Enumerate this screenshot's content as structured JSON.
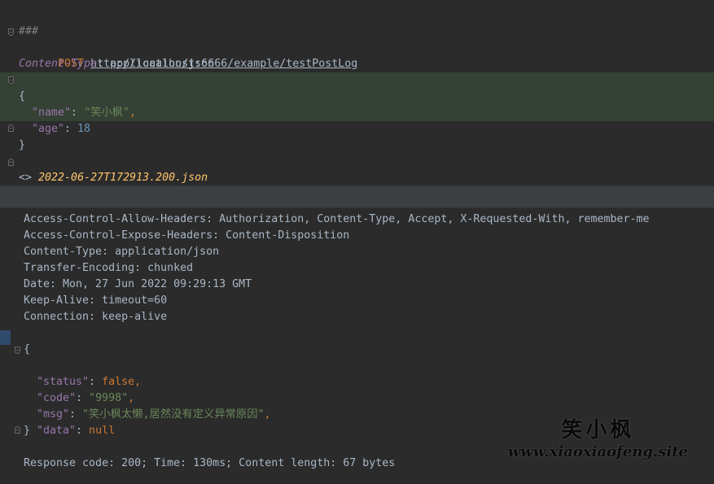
{
  "editor": {
    "separator": "###",
    "method": "POST",
    "url": "http://localhost:6666/example/testPostLog",
    "header_name": "Content-Type",
    "header_sep": ": ",
    "header_value": "application/json",
    "body": {
      "open_brace": "{",
      "line1_key": "\"name\"",
      "line1_colon": ": ",
      "line1_value": "\"笑小枫\"",
      "line1_comma": ",",
      "line2_key": "\"age\"",
      "line2_colon": ": ",
      "line2_value": "18",
      "close_brace": "}"
    },
    "response_ref_prefix": "<> ",
    "response_ref_file": "2022-06-27T172913.200.json"
  },
  "output": {
    "headers": [
      "Access-Control-Allow-Headers: Authorization, Content-Type, Accept, X-Requested-With, remember-me",
      "Access-Control-Expose-Headers: Content-Disposition",
      "Content-Type: application/json",
      "Transfer-Encoding: chunked",
      "Date: Mon, 27 Jun 2022 09:29:13 GMT",
      "Keep-Alive: timeout=60",
      "Connection: keep-alive"
    ],
    "json": {
      "open_brace": "{",
      "status_key": "\"status\"",
      "status_value": "false",
      "code_key": "\"code\"",
      "code_value": "\"9998\"",
      "msg_key": "\"msg\"",
      "msg_value": "\"笑小枫太懒,居然没有定义异常原因\"",
      "data_key": "\"data\"",
      "data_value": "null",
      "colon": ": ",
      "comma": ",",
      "close_brace": "}"
    },
    "summary": "Response code: 200; Time: 130ms; Content length: 67 bytes"
  },
  "watermark": {
    "name": "笑小枫",
    "site": "www.xiaoxiaofeng.site"
  }
}
